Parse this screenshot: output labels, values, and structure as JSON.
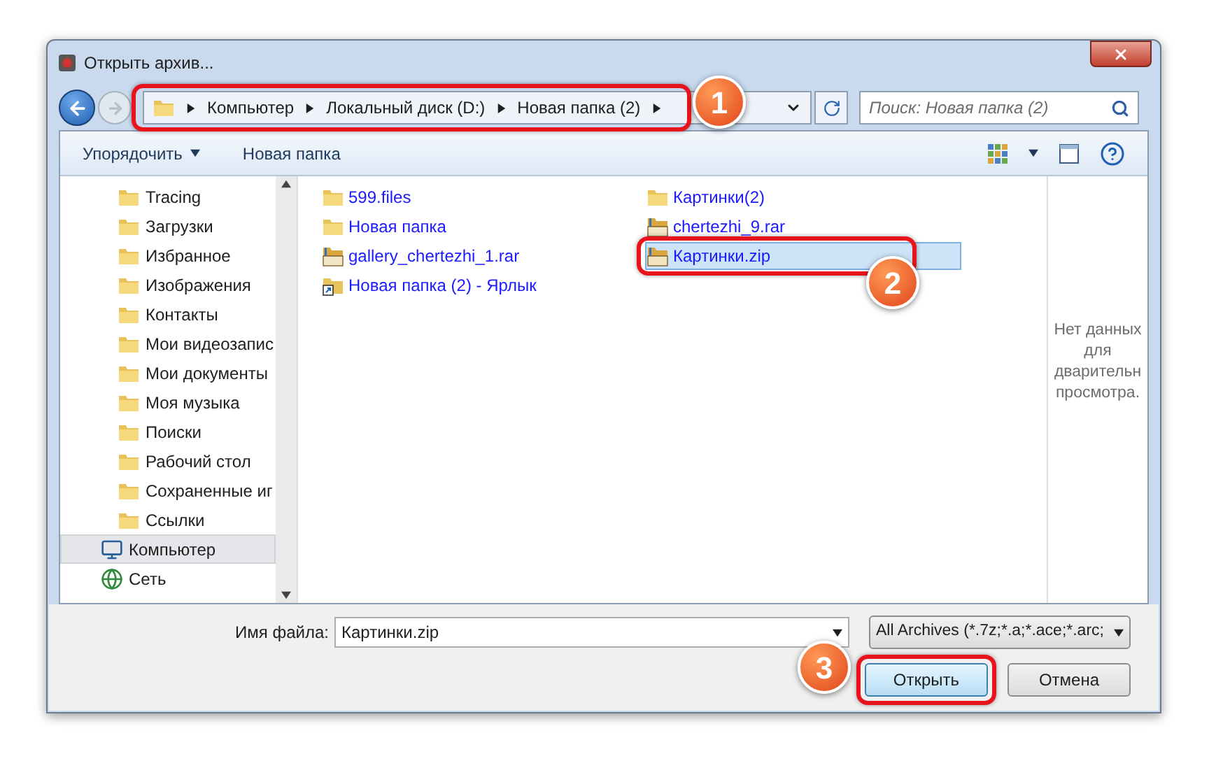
{
  "window": {
    "title": "Открыть архив..."
  },
  "breadcrumb": [
    "Компьютер",
    "Локальный диск (D:)",
    "Новая папка (2)"
  ],
  "search": {
    "placeholder": "Поиск: Новая папка (2)"
  },
  "toolbar": {
    "organize": "Упорядочить",
    "new_folder": "Новая папка"
  },
  "sidebar": {
    "items": [
      {
        "label": "Tracing",
        "kind": "folder",
        "selected": false
      },
      {
        "label": "Загрузки",
        "kind": "folder",
        "selected": false
      },
      {
        "label": "Избранное",
        "kind": "folder",
        "selected": false
      },
      {
        "label": "Изображения",
        "kind": "folder",
        "selected": false
      },
      {
        "label": "Контакты",
        "kind": "folder",
        "selected": false
      },
      {
        "label": "Мои видеозапис",
        "kind": "folder",
        "selected": false
      },
      {
        "label": "Мои документы",
        "kind": "folder",
        "selected": false
      },
      {
        "label": "Моя музыка",
        "kind": "folder",
        "selected": false
      },
      {
        "label": "Поиски",
        "kind": "folder",
        "selected": false
      },
      {
        "label": "Рабочий стол",
        "kind": "folder",
        "selected": false
      },
      {
        "label": "Сохраненные иг",
        "kind": "folder",
        "selected": false
      },
      {
        "label": "Ссылки",
        "kind": "folder",
        "selected": false
      },
      {
        "label": "Компьютер",
        "kind": "computer",
        "selected": true
      },
      {
        "label": "Сеть",
        "kind": "network",
        "selected": false
      }
    ]
  },
  "files": [
    {
      "name": "599.files",
      "kind": "folder",
      "selected": false
    },
    {
      "name": "Новая папка",
      "kind": "folder",
      "selected": false
    },
    {
      "name": "gallery_chertezhi_1.rar",
      "kind": "rar",
      "selected": false
    },
    {
      "name": "Новая папка (2) - Ярлык",
      "kind": "shortcut",
      "selected": false
    },
    {
      "name": "Картинки(2)",
      "kind": "folder",
      "selected": false
    },
    {
      "name": "chertezhi_9.rar",
      "kind": "rar",
      "selected": false
    },
    {
      "name": "Картинки.zip",
      "kind": "zip",
      "selected": true
    }
  ],
  "preview": {
    "message_lines": [
      "Нет данных",
      "для",
      "дварительн",
      "просмотра."
    ]
  },
  "footer": {
    "filename_label": "Имя файла:",
    "filename_value": "Картинки.zip",
    "filter": "All Archives (*.7z;*.a;*.ace;*.arc;",
    "open_button": "Открыть",
    "cancel_button": "Отмена"
  },
  "callouts": [
    {
      "number": "1"
    },
    {
      "number": "2"
    },
    {
      "number": "3"
    }
  ]
}
